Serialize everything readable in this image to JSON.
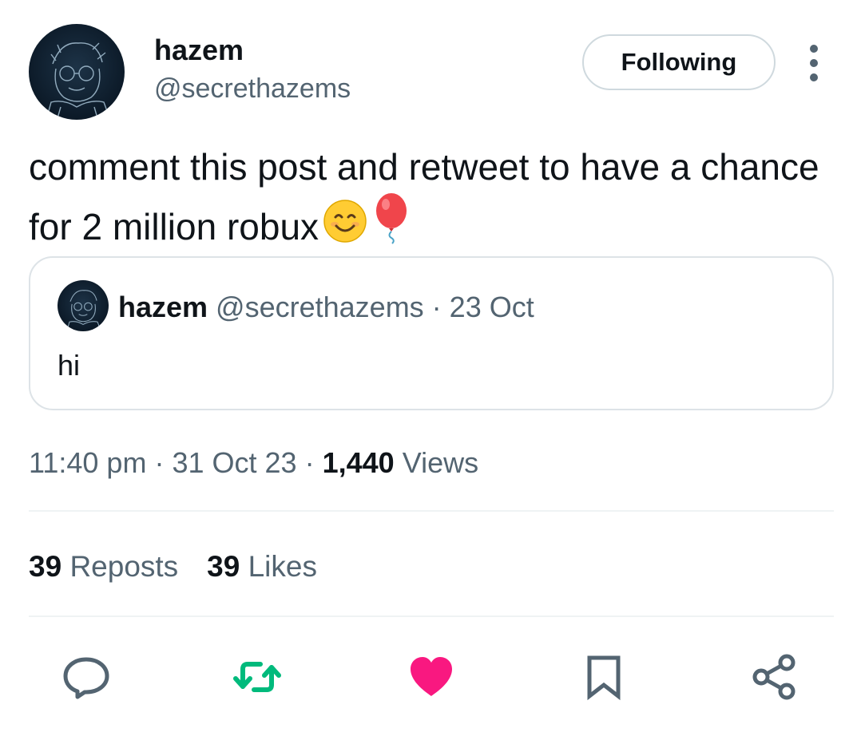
{
  "author": {
    "name": "hazem",
    "handle": "@secrethazems"
  },
  "follow_button": {
    "label": "Following"
  },
  "post": {
    "text": "comment this post and retweet to have a chance  for 2 million robux",
    "emojis": [
      "smiling-face-icon",
      "balloon-icon"
    ]
  },
  "quoted": {
    "name": "hazem",
    "meta": "@secrethazems · 23 Oct",
    "text": "hi"
  },
  "meta": {
    "time": "11:40 pm",
    "sep1": "·",
    "date": "31 Oct 23",
    "sep2": "·",
    "views_count": "1,440",
    "views_label": "Views"
  },
  "stats": {
    "reposts_count": "39",
    "reposts_label": "Reposts",
    "likes_count": "39",
    "likes_label": "Likes"
  },
  "actions": [
    "reply-icon",
    "repost-icon",
    "like-icon",
    "bookmark-icon",
    "share-icon"
  ],
  "colors": {
    "repost_active": "#00ba7c",
    "like_active": "#f91880",
    "secondary_text": "#536471",
    "primary_text": "#0f1419",
    "border": "#cfd9de"
  }
}
